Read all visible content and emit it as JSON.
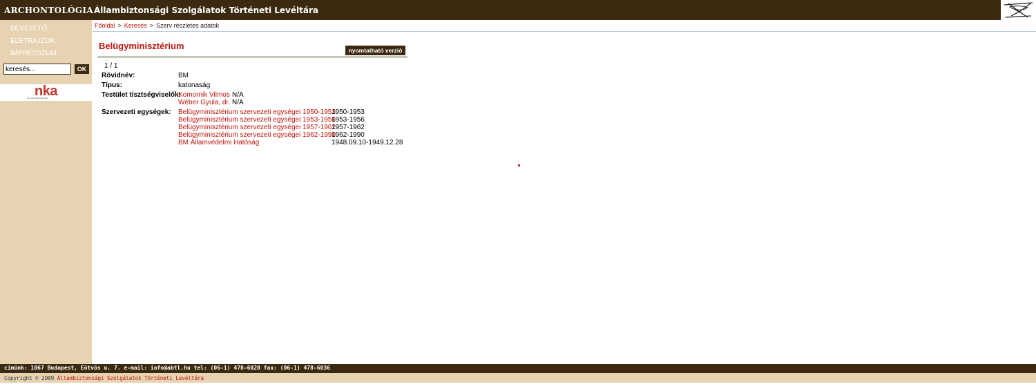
{
  "header": {
    "brand": "ARCHONTOLÓGIA",
    "site_title": "Állambiztonsági Szolgálatok Történeti Levéltára"
  },
  "sidebar": {
    "nav": [
      {
        "label": "BEVEZETŐ"
      },
      {
        "label": "ÉLETRAJZOK"
      },
      {
        "label": "IMPRESSZUM"
      }
    ],
    "search": {
      "placeholder": "keresés...",
      "value": "keresés...",
      "button_label": "OK"
    },
    "partner_logo": {
      "text": "nka",
      "subtitle": "Nemzeti Kulturális Alap"
    }
  },
  "breadcrumb": {
    "items": [
      "Főoldal",
      "Keresés",
      "Szerv részletes adatok"
    ],
    "separator": ">"
  },
  "main": {
    "title": "Belügyminisztérium",
    "print_label": "nyomtatható verzió",
    "page_count": "1 / 1",
    "fields": {
      "rovidnev": {
        "label": "Rövidnév:",
        "value": "BM"
      },
      "tipus": {
        "label": "Típus:",
        "value": "katonaság"
      },
      "tisztsegviselok": {
        "label": "Testület tisztségviselők:",
        "items": [
          {
            "name": "Komornik Vilmos",
            "value": "N/A"
          },
          {
            "name": "Wéber Gyula, dr.",
            "value": "N/A"
          }
        ]
      },
      "egysegek": {
        "label": "Szervezeti egységek:",
        "items": [
          {
            "name": "Belügyminisztérium szervezeti egységei 1950-1953",
            "period": "1950-1953"
          },
          {
            "name": "Belügyminisztérium szervezeti egységei 1953-1956",
            "period": "1953-1956"
          },
          {
            "name": "Belügyminisztérium szervezeti egységei 1957-1962",
            "period": "1957-1962"
          },
          {
            "name": "Belügyminisztérium szervezeti egységei 1962-1990",
            "period": "1962-1990"
          },
          {
            "name": "BM Államvédelmi Hatóság",
            "period": "1948.09.10-1949.12.28"
          }
        ]
      }
    }
  },
  "footer": {
    "contact": "címünk: 1067 Budapest, Eötvös u. 7. e-mail: info@abtl.hu tel: (06-1) 478-6020 fax: (06-1) 478-6036",
    "copyright_prefix": "Copyright © 2009",
    "copyright_org": "Állambiztonsági Szolgálatok Történeti Levéltára"
  },
  "colors": {
    "header_bg": "#3b2a0f",
    "sidebar_bg": "#e7d2b1",
    "link": "#c0140c",
    "white": "#ffffff"
  },
  "icons": [
    "archive-logo-icon",
    "nka-logo"
  ]
}
